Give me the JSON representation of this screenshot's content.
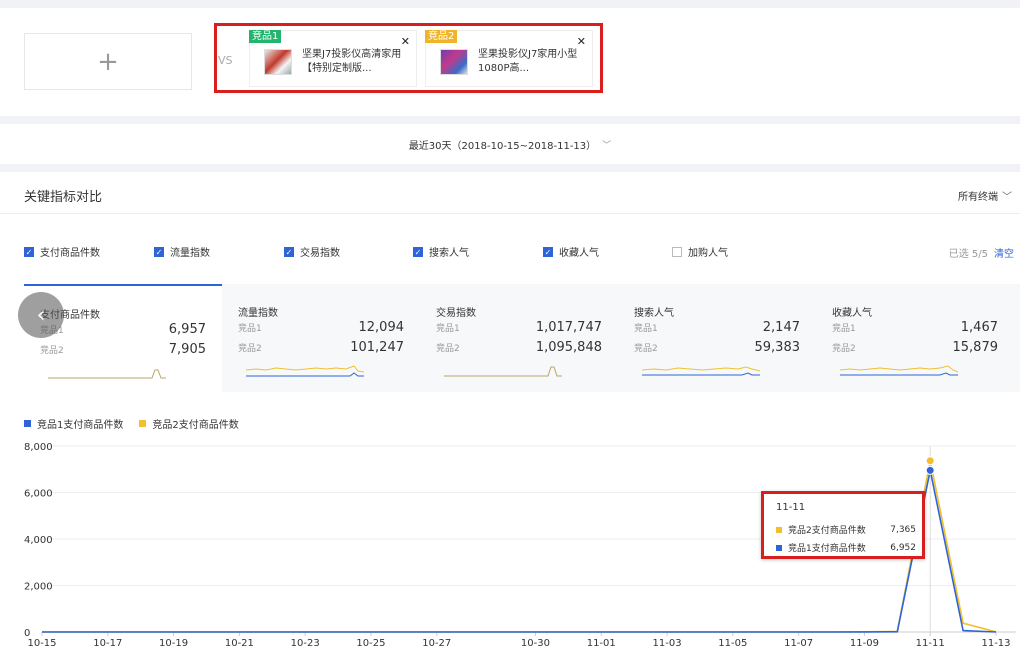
{
  "compare": {
    "add_symbol": "+",
    "vs_label": "VS",
    "products": [
      {
        "tag": "竞品1",
        "title": "坚果J7投影仪高清家用【特别定制版...",
        "tag_color": "#23b46e"
      },
      {
        "tag": "竞品2",
        "title": "坚果投影仪J7家用小型1080P高...",
        "tag_color": "#f0b429"
      }
    ]
  },
  "date_range": {
    "label": "最近30天（2018-10-15~2018-11-13）"
  },
  "section": {
    "title": "关键指标对比",
    "terminal_select": "所有终端"
  },
  "checkboxes": [
    {
      "label": "支付商品件数",
      "checked": true
    },
    {
      "label": "流量指数",
      "checked": true
    },
    {
      "label": "交易指数",
      "checked": true
    },
    {
      "label": "搜索人气",
      "checked": true
    },
    {
      "label": "收藏人气",
      "checked": true
    },
    {
      "label": "加购人气",
      "checked": false
    }
  ],
  "selected_count": "已选 5/5",
  "clear_label": "清空",
  "metric_cards": [
    {
      "name": "支付商品件数",
      "label1": "竞品1",
      "value1": "6,957",
      "label2": "竞品2",
      "value2": "7,905",
      "active": true
    },
    {
      "name": "流量指数",
      "label1": "竞品1",
      "value1": "12,094",
      "label2": "竞品2",
      "value2": "101,247",
      "active": false
    },
    {
      "name": "交易指数",
      "label1": "竞品1",
      "value1": "1,017,747",
      "label2": "竞品2",
      "value2": "1,095,848",
      "active": false
    },
    {
      "name": "搜索人气",
      "label1": "竞品1",
      "value1": "2,147",
      "label2": "竞品2",
      "value2": "59,383",
      "active": false
    },
    {
      "name": "收藏人气",
      "label1": "竞品1",
      "value1": "1,467",
      "label2": "竞品2",
      "value2": "15,879",
      "active": false
    }
  ],
  "nav_symbol": "‹",
  "colors": {
    "series1": "#2e64d6",
    "series2": "#f0c030",
    "accent": "#2e64d6",
    "highlight_border": "#d91e1e"
  },
  "chart_data": {
    "type": "line",
    "x": [
      "10-15",
      "10-16",
      "10-17",
      "10-18",
      "10-19",
      "10-20",
      "10-21",
      "10-22",
      "10-23",
      "10-24",
      "10-25",
      "10-26",
      "10-27",
      "10-28",
      "10-29",
      "10-30",
      "10-31",
      "11-01",
      "11-02",
      "11-03",
      "11-04",
      "11-05",
      "11-06",
      "11-07",
      "11-08",
      "11-09",
      "11-10",
      "11-11",
      "11-12",
      "11-13"
    ],
    "x_ticks": [
      "10-15",
      "10-17",
      "10-19",
      "10-21",
      "10-23",
      "10-25",
      "10-27",
      "10-30",
      "11-01",
      "11-03",
      "11-05",
      "11-07",
      "11-09",
      "11-11",
      "11-13"
    ],
    "series": [
      {
        "name": "竞品1支付商品件数",
        "values": [
          2,
          2,
          2,
          2,
          2,
          2,
          2,
          2,
          2,
          2,
          2,
          2,
          2,
          2,
          2,
          2,
          2,
          2,
          2,
          2,
          2,
          2,
          2,
          2,
          2,
          5,
          10,
          6952,
          60,
          2
        ]
      },
      {
        "name": "竞品2支付商品件数",
        "values": [
          3,
          3,
          3,
          3,
          3,
          3,
          3,
          3,
          3,
          3,
          3,
          3,
          3,
          3,
          3,
          3,
          3,
          3,
          3,
          3,
          3,
          3,
          3,
          3,
          3,
          8,
          20,
          7365,
          380,
          5
        ]
      }
    ],
    "yticks": [
      "0",
      "2,000",
      "4,000",
      "6,000",
      "8,000"
    ],
    "ylim": [
      0,
      8000
    ],
    "grid": true,
    "legend": "top-left"
  },
  "tooltip": {
    "date": "11-11",
    "rows": [
      {
        "label": "竞品2支付商品件数",
        "value": "7,365"
      },
      {
        "label": "竞品1支付商品件数",
        "value": "6,952"
      }
    ]
  }
}
